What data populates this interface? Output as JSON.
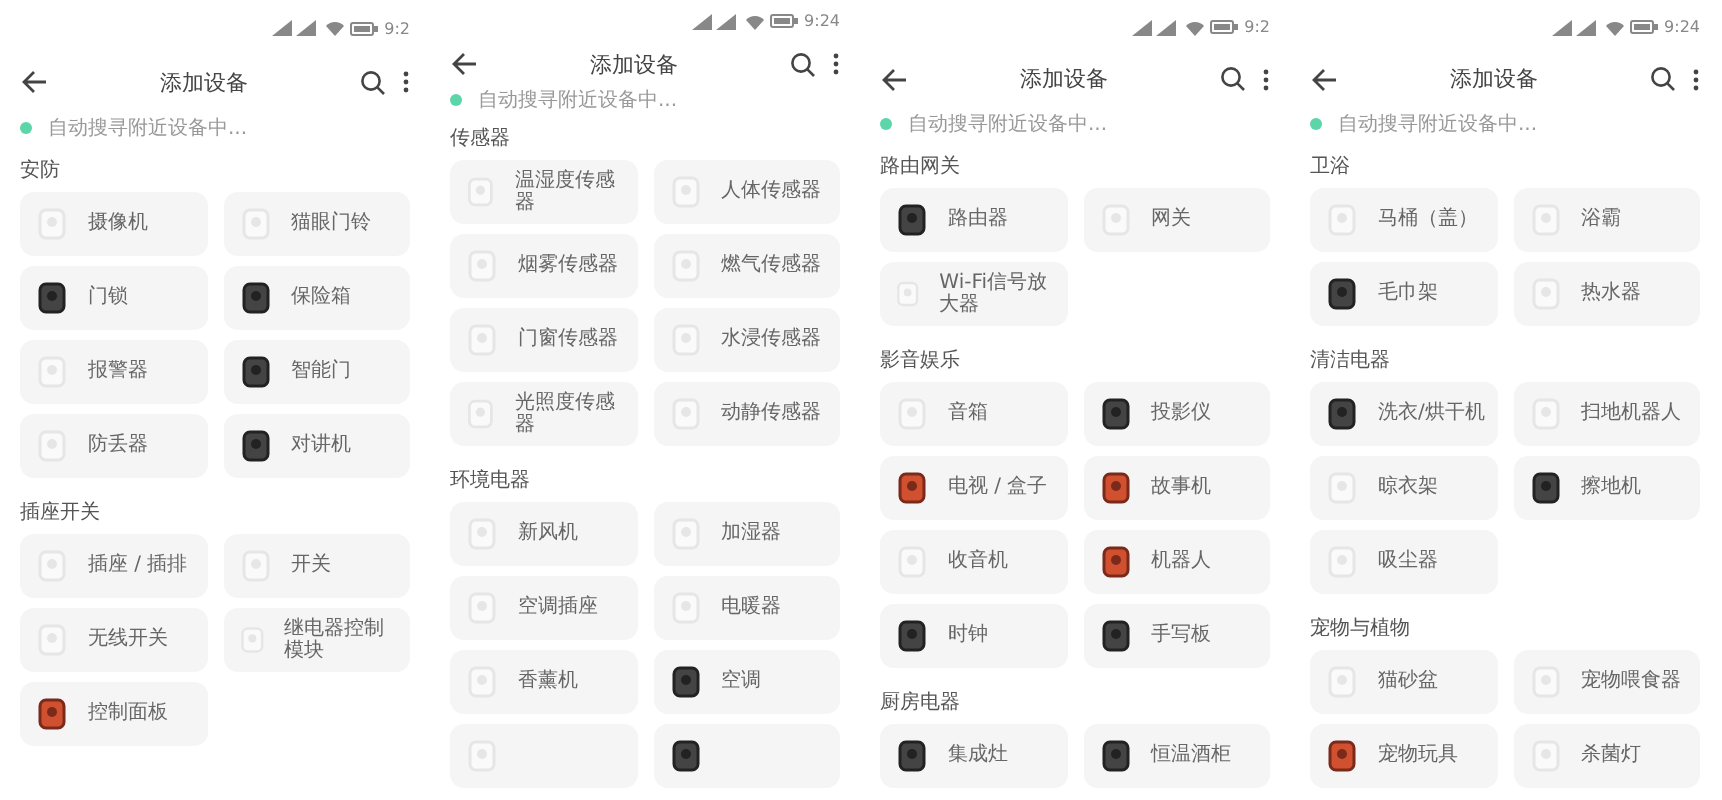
{
  "screens": [
    {
      "time": "9:2",
      "title": "添加设备",
      "scanning": "自动搜寻附近设备中...",
      "sections": [
        {
          "title": "安防",
          "devices": [
            {
              "name": "摄像机",
              "kind": "light"
            },
            {
              "name": "猫眼门铃",
              "kind": "light"
            },
            {
              "name": "门锁",
              "kind": "dark"
            },
            {
              "name": "保险箱",
              "kind": "dark"
            },
            {
              "name": "报警器",
              "kind": "light"
            },
            {
              "name": "智能门",
              "kind": "dark"
            },
            {
              "name": "防丢器",
              "kind": "light"
            },
            {
              "name": "对讲机",
              "kind": "dark"
            }
          ]
        },
        {
          "title": "插座开关",
          "devices": [
            {
              "name": "插座 / 插排",
              "kind": "light"
            },
            {
              "name": "开关",
              "kind": "light"
            },
            {
              "name": "无线开关",
              "kind": "light"
            },
            {
              "name": "继电器控制模块",
              "kind": "light"
            },
            {
              "name": "控制面板",
              "kind": "color"
            }
          ]
        }
      ]
    },
    {
      "time": "9:24",
      "title": "添加设备",
      "scanning": "自动搜寻附近设备中...",
      "sections": [
        {
          "title": "传感器",
          "devices": [
            {
              "name": "温湿度传感器",
              "kind": "light"
            },
            {
              "name": "人体传感器",
              "kind": "light"
            },
            {
              "name": "烟雾传感器",
              "kind": "light"
            },
            {
              "name": "燃气传感器",
              "kind": "light"
            },
            {
              "name": "门窗传感器",
              "kind": "light"
            },
            {
              "name": "水浸传感器",
              "kind": "light"
            },
            {
              "name": "光照度传感器",
              "kind": "light"
            },
            {
              "name": "动静传感器",
              "kind": "light"
            }
          ]
        },
        {
          "title": "环境电器",
          "devices": [
            {
              "name": "新风机",
              "kind": "light"
            },
            {
              "name": "加湿器",
              "kind": "light"
            },
            {
              "name": "空调插座",
              "kind": "light"
            },
            {
              "name": "电暖器",
              "kind": "light"
            },
            {
              "name": "香薰机",
              "kind": "light"
            },
            {
              "name": "空调",
              "kind": "dark"
            },
            {
              "kind": "light"
            },
            {
              "kind": "dark"
            }
          ]
        }
      ]
    },
    {
      "time": "9:2",
      "title": "添加设备",
      "scanning": "自动搜寻附近设备中...",
      "sections": [
        {
          "title": "路由网关",
          "devices": [
            {
              "name": "路由器",
              "kind": "dark"
            },
            {
              "name": "网关",
              "kind": "light"
            },
            {
              "name": "Wi-Fi信号放大器",
              "kind": "light"
            }
          ]
        },
        {
          "title": "影音娱乐",
          "devices": [
            {
              "name": "音箱",
              "kind": "light"
            },
            {
              "name": "投影仪",
              "kind": "dark"
            },
            {
              "name": "电视 / 盒子",
              "kind": "color"
            },
            {
              "name": "故事机",
              "kind": "color"
            },
            {
              "name": "收音机",
              "kind": "light"
            },
            {
              "name": "机器人",
              "kind": "color"
            },
            {
              "name": "时钟",
              "kind": "dark"
            },
            {
              "name": "手写板",
              "kind": "dark"
            }
          ]
        },
        {
          "title": "厨房电器",
          "devices": [
            {
              "name": "集成灶",
              "kind": "dark"
            },
            {
              "name": "恒温酒柜",
              "kind": "dark"
            }
          ]
        }
      ]
    },
    {
      "time": "9:24",
      "title": "添加设备",
      "scanning": "自动搜寻附近设备中...",
      "sections": [
        {
          "title": "卫浴",
          "devices": [
            {
              "name": "马桶（盖）",
              "kind": "light"
            },
            {
              "name": "浴霸",
              "kind": "light"
            },
            {
              "name": "毛巾架",
              "kind": "dark"
            },
            {
              "name": "热水器",
              "kind": "light"
            }
          ]
        },
        {
          "title": "清洁电器",
          "devices": [
            {
              "name": "洗衣/烘干机",
              "kind": "dark"
            },
            {
              "name": "扫地机器人",
              "kind": "light"
            },
            {
              "name": "晾衣架",
              "kind": "light"
            },
            {
              "name": "擦地机",
              "kind": "dark"
            },
            {
              "name": "吸尘器",
              "kind": "light"
            }
          ]
        },
        {
          "title": "宠物与植物",
          "devices": [
            {
              "name": "猫砂盆",
              "kind": "light"
            },
            {
              "name": "宠物喂食器",
              "kind": "light"
            },
            {
              "name": "宠物玩具",
              "kind": "color"
            },
            {
              "name": "杀菌灯",
              "kind": "light"
            }
          ]
        }
      ]
    }
  ]
}
